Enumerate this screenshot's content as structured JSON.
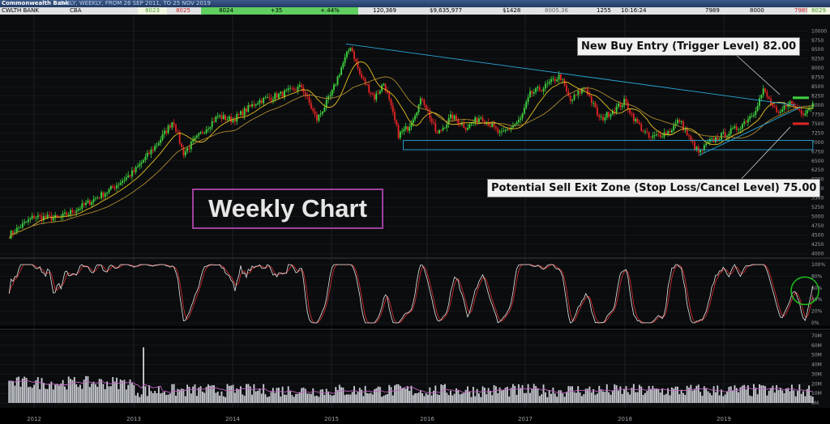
{
  "header": {
    "title": "Commonwealth Bank",
    "subtitle": "DAILY, WEEKLY, FROM 26 SEP 2011, TO 25 NOV 2019"
  },
  "quote": {
    "name": "CWLTH BANK",
    "symbol": "CBA",
    "bid": "8023",
    "ask": "8025",
    "last": "8024",
    "change": "+35",
    "change_pct": "+.44%",
    "volume": "120,369",
    "value": "$9,635,977",
    "trades": "$1428",
    "vwap": "8005.36",
    "f1": "1255",
    "time": "10:16:24",
    "open": "7989",
    "high": "8000",
    "low": "7989",
    "close": "8029"
  },
  "colors": {
    "up": "#3fd23f",
    "down": "#e02424",
    "sma_fast": "#e8c020",
    "sma_slow": "#b08a30",
    "trend": "#2aa8d8",
    "stoch_k": "#e8e8e8",
    "stoch_d": "#e03030",
    "volume": "#c8ccd2",
    "vol_ma": "#c060c0",
    "buy_line": "#3fd23f",
    "sell_line": "#e02424",
    "circle": "#20c020"
  },
  "annotations": {
    "buy": "New Buy Entry (Trigger Level) 82.00",
    "sell": "Potential Sell Exit Zone (Stop Loss/Cancel Level) 75.00",
    "label": "Weekly Chart"
  },
  "chart_data": {
    "type": "candlestick",
    "interval": "weekly",
    "x_ticks": [
      "2012",
      "2013",
      "2014",
      "2015",
      "2016",
      "2017",
      "2018",
      "2019"
    ],
    "price_axis": {
      "ticks": [
        "10000",
        "9750",
        "9500",
        "9250",
        "9000",
        "8750",
        "8500",
        "8250",
        "8000",
        "7750",
        "7500",
        "7250",
        "7000",
        "6750",
        "6500",
        "6250",
        "6000",
        "5750",
        "5500",
        "5250",
        "5000",
        "4750",
        "4500",
        "4250",
        "4000"
      ],
      "ylim": [
        3900,
        10050
      ]
    },
    "price_keypoints": [
      {
        "x": 2011.75,
        "y": 4500
      },
      {
        "x": 2012.0,
        "y": 5000
      },
      {
        "x": 2012.25,
        "y": 4950
      },
      {
        "x": 2012.5,
        "y": 5300
      },
      {
        "x": 2012.75,
        "y": 5700
      },
      {
        "x": 2013.0,
        "y": 6200
      },
      {
        "x": 2013.25,
        "y": 7000
      },
      {
        "x": 2013.4,
        "y": 7600
      },
      {
        "x": 2013.5,
        "y": 6700
      },
      {
        "x": 2013.7,
        "y": 7300
      },
      {
        "x": 2013.85,
        "y": 7700
      },
      {
        "x": 2014.0,
        "y": 7600
      },
      {
        "x": 2014.25,
        "y": 8100
      },
      {
        "x": 2014.5,
        "y": 8300
      },
      {
        "x": 2014.7,
        "y": 8500
      },
      {
        "x": 2014.85,
        "y": 7600
      },
      {
        "x": 2015.0,
        "y": 8300
      },
      {
        "x": 2015.1,
        "y": 9000
      },
      {
        "x": 2015.2,
        "y": 9600
      },
      {
        "x": 2015.3,
        "y": 8800
      },
      {
        "x": 2015.45,
        "y": 8200
      },
      {
        "x": 2015.55,
        "y": 8600
      },
      {
        "x": 2015.7,
        "y": 7200
      },
      {
        "x": 2015.8,
        "y": 7400
      },
      {
        "x": 2015.95,
        "y": 8200
      },
      {
        "x": 2016.1,
        "y": 7200
      },
      {
        "x": 2016.25,
        "y": 7700
      },
      {
        "x": 2016.4,
        "y": 7400
      },
      {
        "x": 2016.55,
        "y": 7700
      },
      {
        "x": 2016.75,
        "y": 7200
      },
      {
        "x": 2016.95,
        "y": 7600
      },
      {
        "x": 2017.05,
        "y": 8300
      },
      {
        "x": 2017.2,
        "y": 8500
      },
      {
        "x": 2017.35,
        "y": 8800
      },
      {
        "x": 2017.45,
        "y": 8100
      },
      {
        "x": 2017.6,
        "y": 8500
      },
      {
        "x": 2017.75,
        "y": 7600
      },
      {
        "x": 2017.9,
        "y": 7900
      },
      {
        "x": 2018.0,
        "y": 8100
      },
      {
        "x": 2018.1,
        "y": 7600
      },
      {
        "x": 2018.25,
        "y": 7100
      },
      {
        "x": 2018.45,
        "y": 7300
      },
      {
        "x": 2018.55,
        "y": 7600
      },
      {
        "x": 2018.65,
        "y": 7100
      },
      {
        "x": 2018.75,
        "y": 6700
      },
      {
        "x": 2018.85,
        "y": 7000
      },
      {
        "x": 2019.0,
        "y": 7200
      },
      {
        "x": 2019.15,
        "y": 7400
      },
      {
        "x": 2019.3,
        "y": 7800
      },
      {
        "x": 2019.4,
        "y": 8400
      },
      {
        "x": 2019.55,
        "y": 7700
      },
      {
        "x": 2019.65,
        "y": 8100
      },
      {
        "x": 2019.8,
        "y": 7800
      },
      {
        "x": 2019.9,
        "y": 8029
      }
    ],
    "trendlines": [
      {
        "type": "resistance",
        "from": {
          "x": 2015.15,
          "y": 9650
        },
        "to": {
          "x": 2019.72,
          "y": 8000
        }
      },
      {
        "type": "support",
        "from": {
          "x": 2018.75,
          "y": 6650
        },
        "to": {
          "x": 2019.78,
          "y": 7950
        }
      }
    ],
    "support_zone": {
      "x0": 2015.75,
      "x1": 2019.9,
      "y0": 6800,
      "y1": 7050
    },
    "levels": {
      "buy_trigger": 8200,
      "stop_loss": 7500
    },
    "stochastic": {
      "ticks": [
        "100%",
        "80%",
        "60%",
        "40%",
        "20%",
        "0%"
      ],
      "ylim": [
        0,
        100
      ],
      "note_circle": {
        "x": 2019.82,
        "y": 55
      }
    },
    "volume": {
      "ticks": [
        "70M",
        "60M",
        "50M",
        "40M",
        "30M",
        "20M",
        "10M",
        "0M"
      ],
      "ylim": [
        0,
        70
      ],
      "spike": {
        "x": 2013.1,
        "value": 58
      }
    }
  }
}
